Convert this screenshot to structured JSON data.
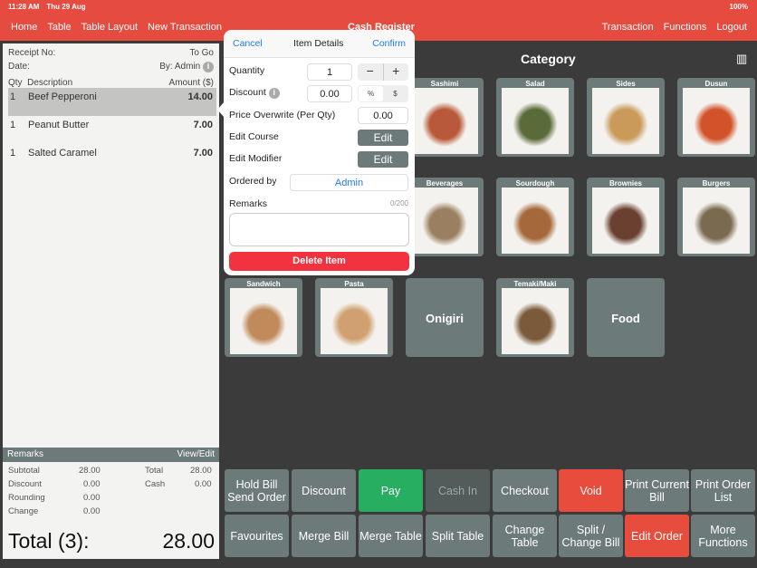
{
  "status": {
    "time": "11:28 AM",
    "date": "Thu 29 Aug",
    "battery": "100%"
  },
  "nav": {
    "left": [
      "Home",
      "Table",
      "Table Layout",
      "New Transaction"
    ],
    "title": "Cash Register",
    "right": [
      "Transaction",
      "Functions",
      "Logout"
    ]
  },
  "receipt": {
    "receipt_no_label": "Receipt No:",
    "order_type": "To Go",
    "date_label": "Date:",
    "by": "By: Admin",
    "col_qty": "Qty",
    "col_desc": "Description",
    "col_amount": "Amount ($)",
    "items": [
      {
        "qty": "1",
        "desc": "Beef Pepperoni",
        "amount": "14.00"
      },
      {
        "qty": "1",
        "desc": "Peanut Butter",
        "amount": "7.00"
      },
      {
        "qty": "1",
        "desc": "Salted Caramel",
        "amount": "7.00"
      }
    ],
    "remarks_label": "Remarks",
    "view_edit": "View/Edit",
    "subtotal_label": "Subtotal",
    "subtotal": "28.00",
    "discount_label": "Discount",
    "discount": "0.00",
    "rounding_label": "Rounding",
    "rounding": "0.00",
    "change_label": "Change",
    "change": "0.00",
    "total_label": "Total",
    "total": "28.00",
    "cash_label": "Cash",
    "cash": "0.00",
    "grand_label": "Total (3):",
    "grand": "28.00"
  },
  "category": {
    "title": "Category",
    "tiles": [
      {
        "label": "Sashimi",
        "color": "#b85a3a"
      },
      {
        "label": "Salad",
        "color": "#5a6b3a"
      },
      {
        "label": "Sides",
        "color": "#c99a5a"
      },
      {
        "label": "Dusun",
        "color": "#d2522a"
      },
      {
        "label": "Beverages",
        "color": "#9a8060"
      },
      {
        "label": "Sourdough",
        "color": "#a4683a"
      },
      {
        "label": "Brownies",
        "color": "#6a4030"
      },
      {
        "label": "Burgers",
        "color": "#7a6a50"
      },
      {
        "label": "Sandwich",
        "color": "#c08a5a"
      },
      {
        "label": "Pasta",
        "color": "#d0a070"
      },
      {
        "label": "Onigiri"
      },
      {
        "label": "Temaki/Maki",
        "color": "#7a5a3a"
      },
      {
        "label": "Food"
      }
    ]
  },
  "popover": {
    "cancel": "Cancel",
    "title": "Item Details",
    "confirm": "Confirm",
    "quantity_label": "Quantity",
    "quantity": "1",
    "minus": "−",
    "plus": "+",
    "discount_label": "Discount",
    "discount": "0.00",
    "pct": "%",
    "dollar": "$",
    "price_label": "Price Overwrite (Per Qty)",
    "price": "0.00",
    "course_label": "Edit Course",
    "modifier_label": "Edit Modifier",
    "edit": "Edit",
    "ordered_label": "Ordered by",
    "ordered_by": "Admin",
    "remarks_label": "Remarks",
    "remarks_count": "0/200",
    "remarks_value": "",
    "delete": "Delete Item"
  },
  "actions": [
    [
      "Hold Bill Send Order",
      "Discount",
      "Pay",
      "Cash In",
      "Checkout",
      "Void",
      "Print Current Bill",
      "Print Order List"
    ],
    [
      "Favourites",
      "Merge Bill",
      "Merge Table",
      "Split Table",
      "Change Table",
      "Split / Change Bill",
      "Edit Order",
      "More Functions"
    ]
  ],
  "colors": {
    "accent": "#e54b3e",
    "pay": "#27ae60",
    "void": "#e84c3d",
    "button": "#6d7a7a",
    "link": "#1e7cf2",
    "delete": "#f2333f"
  }
}
